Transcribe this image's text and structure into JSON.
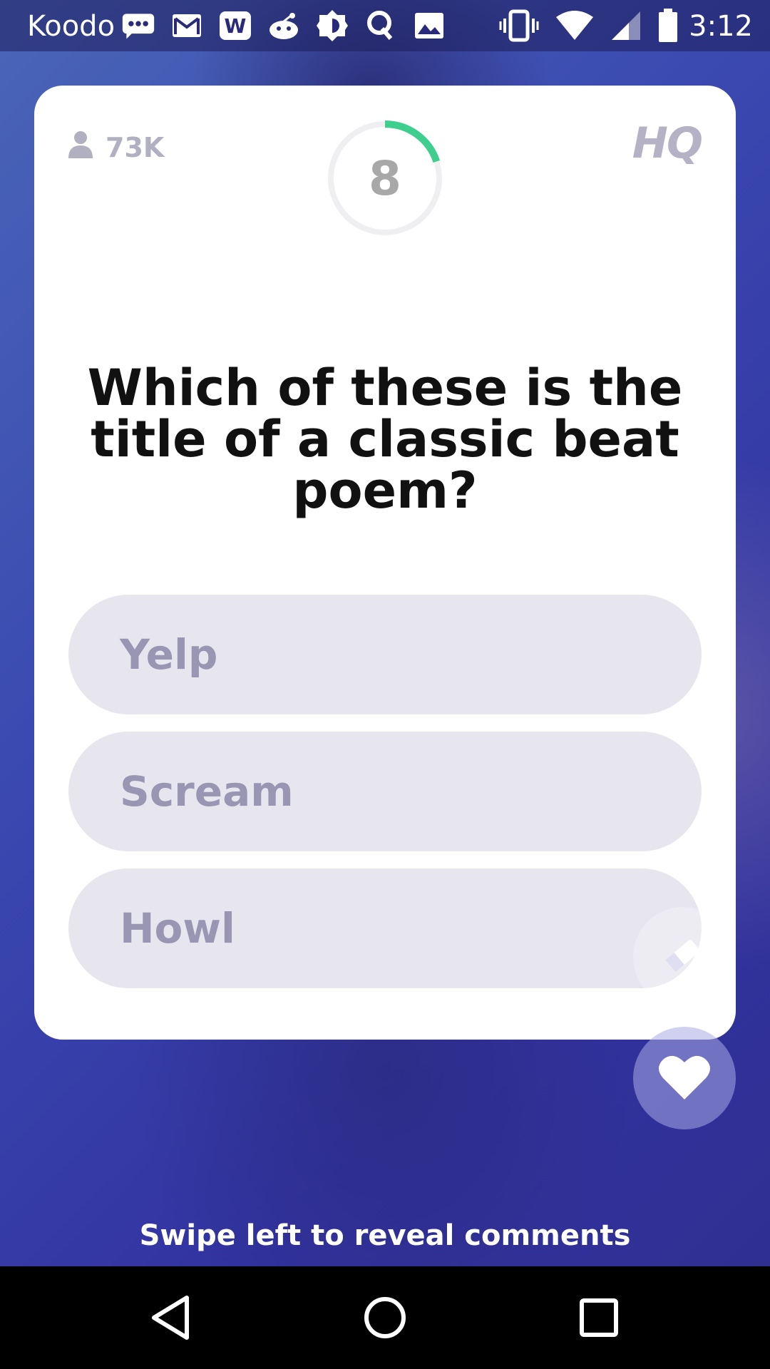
{
  "status_bar": {
    "carrier": "Koodo",
    "time": "3:12",
    "left_icons": [
      "message-icon",
      "gmail-icon",
      "word-icon",
      "reddit-icon",
      "brightness-icon",
      "quora-icon",
      "image-icon"
    ],
    "right_icons": [
      "vibrate-icon",
      "wifi-icon",
      "signal-icon",
      "battery-icon"
    ]
  },
  "card": {
    "viewer_count": "73K",
    "timer_value": "8",
    "timer_progress": 0.2,
    "logo": "HQ",
    "question": "Which of these is the title of a classic beat poem?",
    "answers": [
      {
        "label": "Yelp"
      },
      {
        "label": "Scream"
      },
      {
        "label": "Howl"
      }
    ]
  },
  "swipe_hint": "Swipe left to reveal comments",
  "colors": {
    "timer_accent": "#3ecf8e",
    "answer_bg": "#e7e6ee",
    "answer_text": "#9996b4"
  }
}
